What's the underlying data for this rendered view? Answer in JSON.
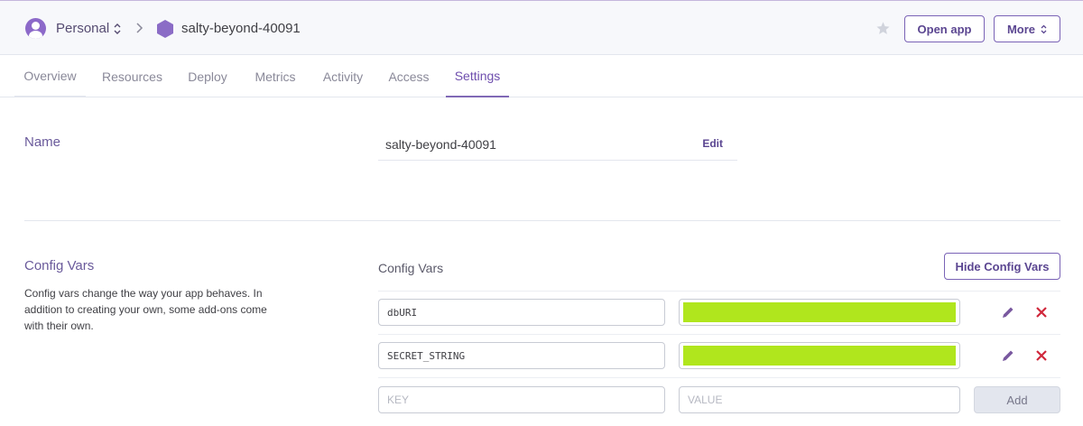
{
  "header": {
    "account_label": "Personal",
    "app_name": "salty-beyond-40091",
    "open_app_label": "Open app",
    "more_label": "More"
  },
  "tabs": [
    {
      "label": "Overview"
    },
    {
      "label": "Resources"
    },
    {
      "label": "Deploy"
    },
    {
      "label": "Metrics"
    },
    {
      "label": "Activity"
    },
    {
      "label": "Access"
    },
    {
      "label": "Settings",
      "active": true
    }
  ],
  "name_section": {
    "title": "Name",
    "value": "salty-beyond-40091",
    "edit_label": "Edit"
  },
  "config_vars": {
    "title": "Config Vars",
    "description": "Config vars change the way your app behaves. In addition to creating your own, some add-ons come with their own.",
    "subtitle": "Config Vars",
    "hide_label": "Hide Config Vars",
    "vars": [
      {
        "key": "dbURI"
      },
      {
        "key": "SECRET_STRING"
      }
    ],
    "new_key_placeholder": "KEY",
    "new_value_placeholder": "VALUE",
    "add_label": "Add"
  },
  "colors": {
    "accent": "#79589f",
    "delete": "#d0273a",
    "masked_value": "#b0e61d"
  }
}
